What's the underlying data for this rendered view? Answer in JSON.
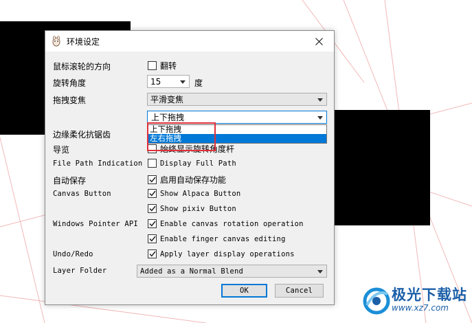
{
  "dialog": {
    "title": "环境设定",
    "close_icon": "close-icon"
  },
  "settings": {
    "wheel_direction": {
      "label": "鼠标滚轮的方向",
      "option": "翻转",
      "checked": false
    },
    "rotation_angle": {
      "label": "旋转角度",
      "value": "15",
      "unit": "度"
    },
    "drag_zoom": {
      "label": "拖拽变焦",
      "value": "平滑变焦"
    },
    "drag_direction": {
      "value": "上下拖拽",
      "options": [
        "上下拖拽",
        "左右拖拽"
      ],
      "highlighted_option": "左右拖拽"
    },
    "edge_antialias": {
      "label": "边缘柔化抗锯齿"
    },
    "navigator": {
      "label": "导览",
      "option": "始终显示旋转角度杆",
      "checked": false
    },
    "file_path": {
      "label": "File Path Indication",
      "option": "Display Full Path",
      "checked": false
    },
    "autosave": {
      "label": "自动保存",
      "option": "启用自动保存功能",
      "checked": true
    },
    "canvas_button": {
      "label": "Canvas Button",
      "options": [
        {
          "text": "Show Alpaca Button",
          "checked": true
        },
        {
          "text": "Show pixiv Button",
          "checked": true
        }
      ]
    },
    "windows_pointer": {
      "label": "Windows Pointer API",
      "options": [
        {
          "text": "Enable canvas rotation operation",
          "checked": true
        },
        {
          "text": "Enable finger canvas editing",
          "checked": true
        }
      ]
    },
    "undo_redo": {
      "label": "Undo/Redo",
      "option": "Apply layer display operations",
      "checked": true
    },
    "layer_folder": {
      "label": "Layer Folder",
      "value": "Added as a Normal Blend"
    }
  },
  "buttons": {
    "ok": "OK",
    "cancel": "Cancel"
  },
  "watermark": {
    "name": "极光下载站",
    "url": "www.xz7.com"
  },
  "colors": {
    "accent": "#0078d7",
    "highlight_box": "#e0303a",
    "watermark": "#1b5fa8"
  }
}
